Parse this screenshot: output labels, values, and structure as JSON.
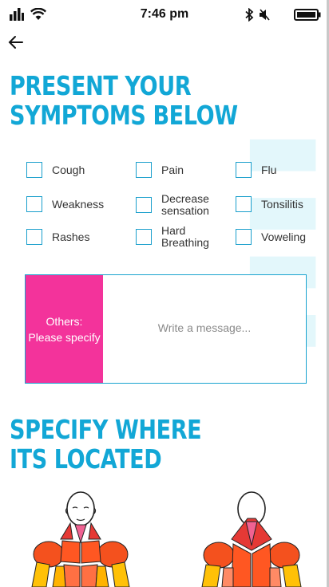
{
  "status_bar": {
    "time": "7:46 pm"
  },
  "header": {
    "back_icon": "arrow-left-icon"
  },
  "section1": {
    "line1": "PRESENT YOUR",
    "line2": "SYMPTOMS BELOW"
  },
  "symptoms": [
    {
      "label": "Cough"
    },
    {
      "label": "Pain"
    },
    {
      "label": "Flu"
    },
    {
      "label": "Weakness"
    },
    {
      "label": "Decrease\nsensation"
    },
    {
      "label": "Tonsilitis"
    },
    {
      "label": "Rashes"
    },
    {
      "label": "Hard\nBreathing"
    },
    {
      "label": "Voweling"
    }
  ],
  "others": {
    "line1": "Others:",
    "line2": "Please specify",
    "placeholder": "Write a message..."
  },
  "section2": {
    "line1": "SPECIFY WHERE",
    "line2": "ITS LOCATED"
  },
  "body_figures": {
    "front": "body-front-figure",
    "back": "body-back-figure"
  },
  "colors": {
    "accent_blue": "#12a7d6",
    "others_pink": "#f3339b"
  }
}
